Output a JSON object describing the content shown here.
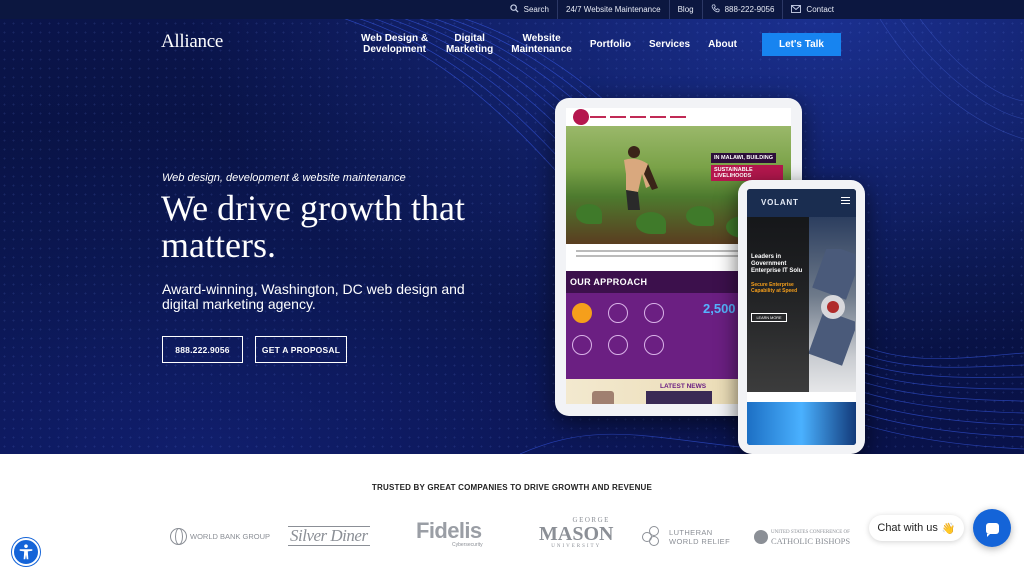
{
  "utility_bar": {
    "items": [
      {
        "label": "Search",
        "icon": "search-icon"
      },
      {
        "label": "24/7 Website Maintenance",
        "icon": ""
      },
      {
        "label": "Blog",
        "icon": ""
      },
      {
        "label": "888-222-9056",
        "icon": "phone-icon"
      },
      {
        "label": "Contact",
        "icon": "mail-icon"
      }
    ]
  },
  "header": {
    "logo": "Alliance",
    "nav": [
      "Web Design &\nDevelopment",
      "Digital\nMarketing",
      "Website\nMaintenance",
      "Portfolio",
      "Services",
      "About"
    ],
    "cta": "Let's Talk"
  },
  "hero": {
    "eyebrow": "Web design, development & website maintenance",
    "headline": "We drive growth that matters.",
    "subhead": "Award-winning, Washington, DC web design and digital marketing agency.",
    "phone_button": "888.222.9056",
    "proposal_button": "GET A PROPOSAL"
  },
  "tablet_mockup": {
    "banner_line1": "IN MALAWI, BUILDING",
    "banner_line2": "SUSTAINABLE LIVELIHOODS",
    "section_title": "OUR APPROACH",
    "stat": "2,500",
    "news_title": "LATEST NEWS"
  },
  "phone_mockup": {
    "brand": "VOLANT",
    "heading": "Leaders in Government Enterprise IT Solu",
    "subheading": "Secure Enterprise Capability at Speed",
    "button": "LEARN MORE"
  },
  "trusted": {
    "heading": "TRUSTED BY GREAT COMPANIES TO DRIVE GROWTH AND REVENUE",
    "logos": {
      "world_bank": "WORLD BANK GROUP",
      "silver_diner": "Silver Diner",
      "fidelis": "Fidelis",
      "fidelis_sub": "Cybersecurity",
      "gm_top": "GEORGE",
      "gm_main": "MASON",
      "gm_bottom": "UNIVERSITY",
      "lwr_line1": "LUTHERAN",
      "lwr_line2": "WORLD RELIEF",
      "usccb_line1": "UNITED STATES CONFERENCE OF",
      "usccb_line2": "CATHOLIC BISHOPS"
    }
  },
  "chat": {
    "label": "Chat with us",
    "emoji": "👋"
  },
  "colors": {
    "navy": "#0a144a",
    "accent_blue": "#1784f0",
    "chat_blue": "#1464d8"
  }
}
